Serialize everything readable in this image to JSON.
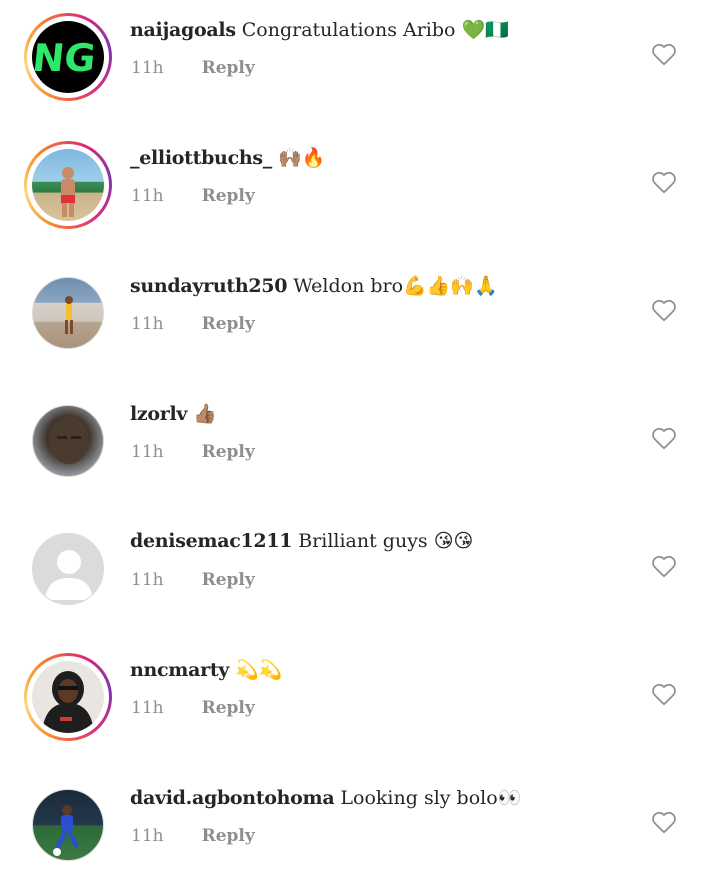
{
  "comments": [
    {
      "username": "naijagoals",
      "text": "Congratulations Aribo",
      "emoji": "💚🇳🇬",
      "time": "11h",
      "reply": "Reply",
      "avatar": "ng-logo",
      "story_ring": true
    },
    {
      "username": "_elliottbuchs_",
      "text": "",
      "emoji": "🙌🏽🔥",
      "time": "11h",
      "reply": "Reply",
      "avatar": "beach-photo",
      "story_ring": true
    },
    {
      "username": "sundayruth250",
      "text": "Weldon bro",
      "emoji": "💪👍🙌🙏",
      "time": "11h",
      "reply": "Reply",
      "avatar": "stadium-photo",
      "story_ring": false
    },
    {
      "username": "lzorlv",
      "text": "",
      "emoji": "👍🏽",
      "time": "11h",
      "reply": "Reply",
      "avatar": "face-photo",
      "story_ring": false
    },
    {
      "username": "denisemac1211",
      "text": "Brilliant guys",
      "emoji": "😘😘",
      "time": "11h",
      "reply": "Reply",
      "avatar": "default-avatar",
      "story_ring": false
    },
    {
      "username": "nncmarty",
      "text": "",
      "emoji": "💫💫",
      "time": "11h",
      "reply": "Reply",
      "avatar": "hoodie-photo",
      "story_ring": true
    },
    {
      "username": "david.agbontohoma",
      "text": "Looking sly bolo",
      "emoji": "👀",
      "time": "11h",
      "reply": "Reply",
      "avatar": "football-photo",
      "story_ring": false
    }
  ],
  "icons": {
    "like": "heart-outline-icon"
  },
  "colors": {
    "ring_start": "#f58529",
    "ring_end": "#dd2a7b",
    "meta_gray": "#8e8e8e",
    "ng_green": "#2ee86a"
  }
}
